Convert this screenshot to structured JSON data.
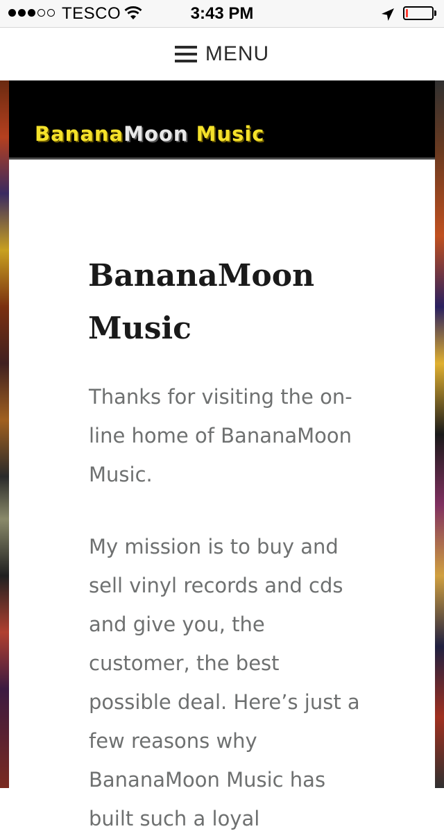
{
  "status_bar": {
    "carrier": "TESCO",
    "time": "3:43 PM",
    "signal_bars_filled": 3,
    "signal_bars_total": 5,
    "battery_level": 0.08,
    "icons": [
      "wifi-icon",
      "location-arrow-icon",
      "battery-icon"
    ]
  },
  "nav": {
    "menu_label": "MENU",
    "menu_icon": "hamburger-icon"
  },
  "header": {
    "logo_part1": "Banana",
    "logo_part2": "Moon",
    "logo_part3": " Music",
    "logo_icon": "crescent-moon-icon"
  },
  "content": {
    "title": "BananaMoon Music",
    "paragraph_1": "Thanks for visiting the on-line home of BananaMoon Music.",
    "paragraph_2": "My mission is to buy and sell vinyl records and cds and give you, the customer, the best possible deal. Here’s just a few reasons why BananaMoon Music has built such a loyal"
  },
  "colors": {
    "logo_yellow": "#f5e22a",
    "body_text": "#6e7070",
    "title_text": "#1a1a1a",
    "battery_low": "#ff3b30"
  }
}
